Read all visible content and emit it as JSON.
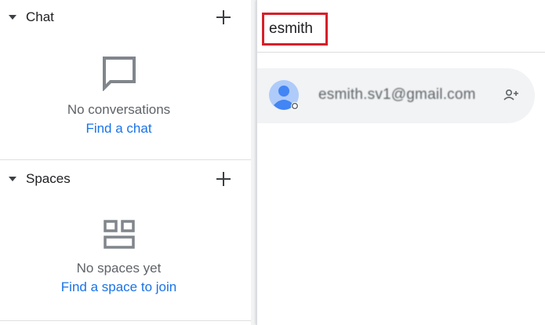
{
  "chat": {
    "title": "Chat",
    "empty_text": "No conversations",
    "empty_link": "Find a chat"
  },
  "spaces": {
    "title": "Spaces",
    "empty_text": "No spaces yet",
    "empty_link": "Find a space to join"
  },
  "search": {
    "value": "esmith"
  },
  "results": [
    {
      "email": "esmith.sv1@gmail.com"
    }
  ],
  "colors": {
    "link": "#1a73e8",
    "highlight_border": "#d71f2a",
    "avatar": "#aecbfa",
    "avatar_head": "#4285f4",
    "icon_gray": "#80868b"
  }
}
